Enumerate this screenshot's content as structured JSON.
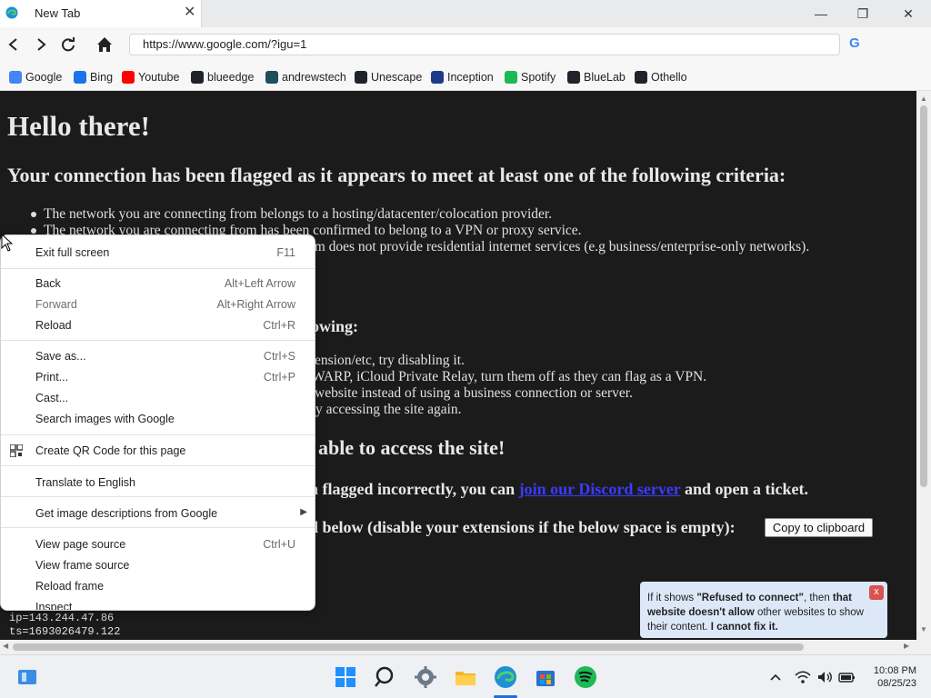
{
  "browser": {
    "tab_title": "New Tab",
    "tab_close": "✕",
    "window_controls": {
      "minimize": "—",
      "maximize": "❐",
      "close": "✕"
    },
    "address": "https://www.google.com/?igu=1",
    "search_engine_icon": "G",
    "bookmarks": [
      {
        "label": "Google",
        "icon": "google-icon",
        "color": "#4285f4"
      },
      {
        "label": "Bing",
        "icon": "bing-icon",
        "color": "#1a73e8"
      },
      {
        "label": "Youtube",
        "icon": "youtube-icon",
        "color": "#ff0000"
      },
      {
        "label": "blueedge",
        "icon": "react-icon",
        "color": "#20232a"
      },
      {
        "label": "andrewstech",
        "icon": "andrewstech-icon",
        "color": "#1f4f5a"
      },
      {
        "label": "Unescape",
        "icon": "react-icon",
        "color": "#20232a"
      },
      {
        "label": "Inception",
        "icon": "inception-icon",
        "color": "#1e3a8a"
      },
      {
        "label": "Spotify",
        "icon": "spotify-icon",
        "color": "#1db954"
      },
      {
        "label": "BlueLab",
        "icon": "react-icon",
        "color": "#20232a"
      },
      {
        "label": "Othello",
        "icon": "react-icon",
        "color": "#20232a"
      }
    ]
  },
  "page": {
    "heading": "Hello there!",
    "criteria_heading": "Your connection has been flagged as it appears to meet at least one of the following criteria:",
    "criteria": [
      "The network you are connecting from belongs to a hosting/datacenter/colocation provider.",
      "The network you are connecting from has been confirmed to belong to a VPN or proxy service.",
      "g from does not provide residential internet services (e.g business/enterprise-only networks)."
    ],
    "fixes_heading_fragment": "owing:",
    "fixes": [
      "ension/etc, try disabling it.",
      "WARP, iCloud Private Relay, turn them off as they can flag as a VPN.",
      "website instead of using a business connection or server.",
      "y accessing the site again."
    ],
    "unable_heading_fragment": "able to access the site!",
    "flagged_prefix": "n flagged incorrectly, you can ",
    "flagged_link": "join our Discord server",
    "flagged_suffix": " and open a ticket.",
    "below_fragment": "d below (disable your extensions if the below space is empty):",
    "copy_button": "Copy to clipboard",
    "diag_ip": "ip=143.244.47.86",
    "diag_ts": "ts=1693026479.122"
  },
  "context_menu": {
    "items": [
      {
        "label": "Exit full screen",
        "shortcut": "F11",
        "disabled": false
      },
      {
        "label": "Back",
        "shortcut": "Alt+Left Arrow",
        "disabled": false
      },
      {
        "label": "Forward",
        "shortcut": "Alt+Right Arrow",
        "disabled": true
      },
      {
        "label": "Reload",
        "shortcut": "Ctrl+R",
        "disabled": false
      },
      {
        "label": "Save as...",
        "shortcut": "Ctrl+S",
        "disabled": false
      },
      {
        "label": "Print...",
        "shortcut": "Ctrl+P",
        "disabled": false
      },
      {
        "label": "Cast...",
        "shortcut": "",
        "disabled": false
      },
      {
        "label": "Search images with Google",
        "shortcut": "",
        "disabled": false
      },
      {
        "label": "Create QR Code for this page",
        "shortcut": "",
        "disabled": false
      },
      {
        "label": "Translate to English",
        "shortcut": "",
        "disabled": false
      },
      {
        "label": "Get image descriptions from Google",
        "shortcut": "",
        "disabled": false
      },
      {
        "label": "View page source",
        "shortcut": "Ctrl+U",
        "disabled": false
      },
      {
        "label": "View frame source",
        "shortcut": "",
        "disabled": false
      },
      {
        "label": "Reload frame",
        "shortcut": "",
        "disabled": false
      },
      {
        "label": "Inspect",
        "shortcut": "",
        "disabled": false
      }
    ]
  },
  "toast": {
    "text_1": "If it shows ",
    "text_bold_1": "\"Refused to connect\"",
    "text_2": ", then ",
    "text_bold_2": "that website doesn't allow",
    "text_3": " other websites to show their content. ",
    "text_bold_3": "I cannot fix it.",
    "close": "x"
  },
  "taskbar": {
    "time": "10:08 PM",
    "date": "08/25/23",
    "apps": [
      "widgets-icon",
      "start-icon",
      "search-icon",
      "settings-icon",
      "file-explorer-icon",
      "edge-icon",
      "store-icon",
      "spotify-icon"
    ],
    "tray": [
      "chevron-up-icon",
      "wifi-icon",
      "volume-icon",
      "battery-icon"
    ]
  },
  "colors": {
    "page_bg": "#1b1b1b",
    "page_text": "#e8e8e8",
    "link": "#3b3bff",
    "toast_bg": "#dce8f8",
    "toast_close": "#d9534f"
  }
}
